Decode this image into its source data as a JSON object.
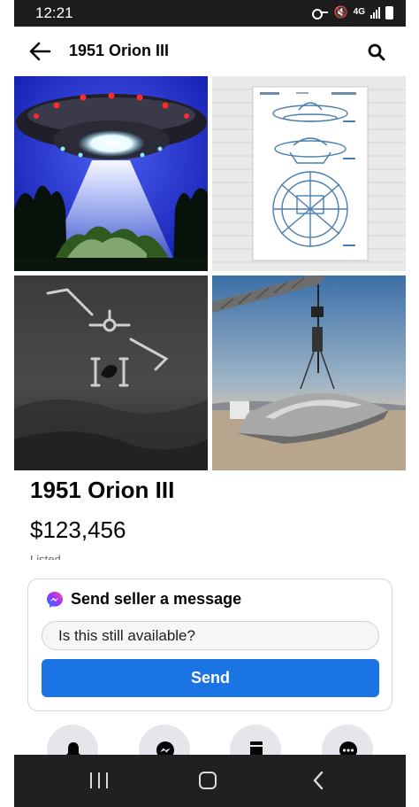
{
  "status_bar": {
    "time": "12:21",
    "network": "4G",
    "icons": [
      "key-icon",
      "mute-icon",
      "4g-icon",
      "signal-icon",
      "battery-icon"
    ]
  },
  "header": {
    "title": "1951 Orion III",
    "back_icon": "back-arrow-icon",
    "search_icon": "search-icon"
  },
  "photos": [
    {
      "name": "ufo-beam-night-photo"
    },
    {
      "name": "patent-drawing-photo"
    },
    {
      "name": "infrared-ufo-photo"
    },
    {
      "name": "crane-lifting-saucer-photo"
    }
  ],
  "listing": {
    "title": "1951 Orion III",
    "price": "$123,456",
    "meta": "Listed ..."
  },
  "message": {
    "heading": "Send seller a message",
    "input_value": "Is this still available?",
    "send_label": "Send"
  },
  "actions": [
    {
      "icon": "bell-icon"
    },
    {
      "icon": "messenger-icon"
    },
    {
      "icon": "save-icon"
    },
    {
      "icon": "more-icon"
    }
  ],
  "colors": {
    "accent": "#1b74e4",
    "status_bar": "#1c1c1c",
    "nav_bar": "#202020"
  }
}
